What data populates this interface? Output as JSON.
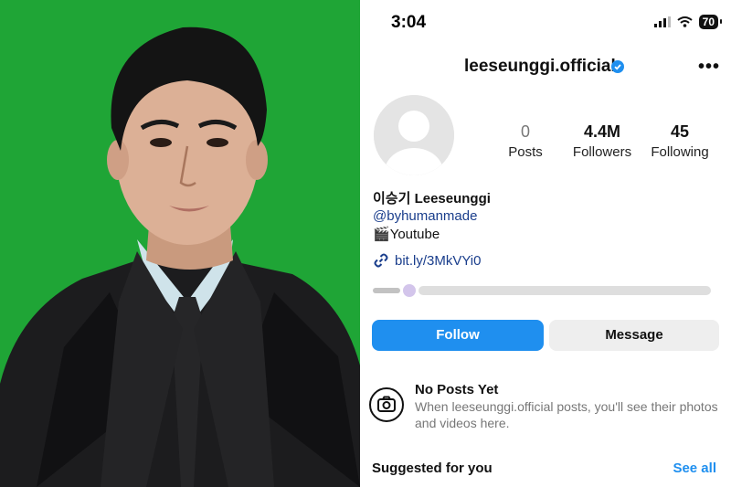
{
  "status_bar": {
    "time": "3:04",
    "battery": "70",
    "icons": [
      "signal-icon",
      "wifi-icon",
      "battery-icon"
    ]
  },
  "profile": {
    "username": "leeseunggi.official",
    "verified": true,
    "display_name": "이승기 Leeseunggi",
    "mention": "@byhumanmade",
    "bio_line": "Youtube",
    "link": "bit.ly/3MkVYi0"
  },
  "stats": [
    {
      "value": "0",
      "label": "Posts"
    },
    {
      "value": "4.4M",
      "label": "Followers"
    },
    {
      "value": "45",
      "label": "Following"
    }
  ],
  "buttons": {
    "follow": "Follow",
    "message": "Message"
  },
  "empty_state": {
    "title": "No Posts Yet",
    "description": "When leeseunggi.official posts, you'll see their photos and videos here."
  },
  "suggested": {
    "title": "Suggested for you",
    "see_all": "See all"
  },
  "colors": {
    "accent": "#1f8fef",
    "photo_background": "#1fa536",
    "link": "#1a3e8c"
  }
}
